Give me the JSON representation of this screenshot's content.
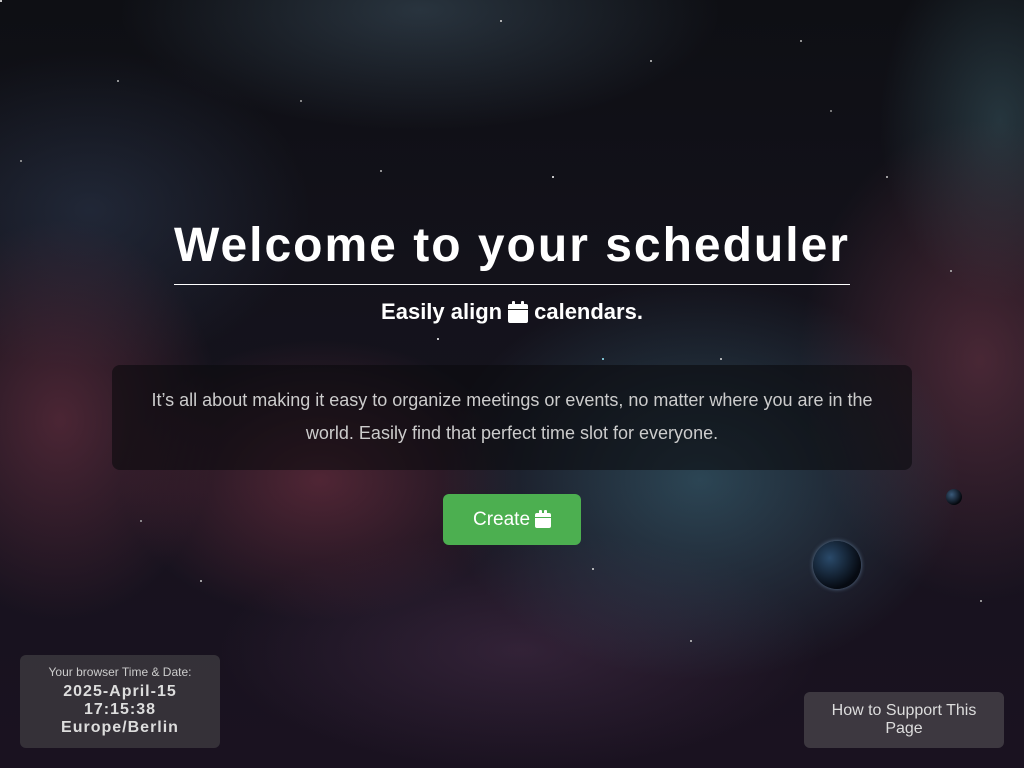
{
  "hero": {
    "title": "Welcome to your scheduler",
    "subtitle_before": "Easily align",
    "subtitle_icon": "calendar-icon",
    "subtitle_after": "calendars."
  },
  "intro": {
    "text": "It’s all about making it easy to organize meetings or events, no matter where you are in the world. Easily find that perfect time slot for everyone."
  },
  "create_button": {
    "label": "Create",
    "icon": "calendar-icon",
    "color": "#4caf50"
  },
  "browser_time": {
    "label": "Your browser Time & Date:",
    "date": "2025-April-15",
    "time": "17:15:38",
    "timezone": "Europe/Berlin"
  },
  "support_link": {
    "label": "How to Support This Page"
  }
}
